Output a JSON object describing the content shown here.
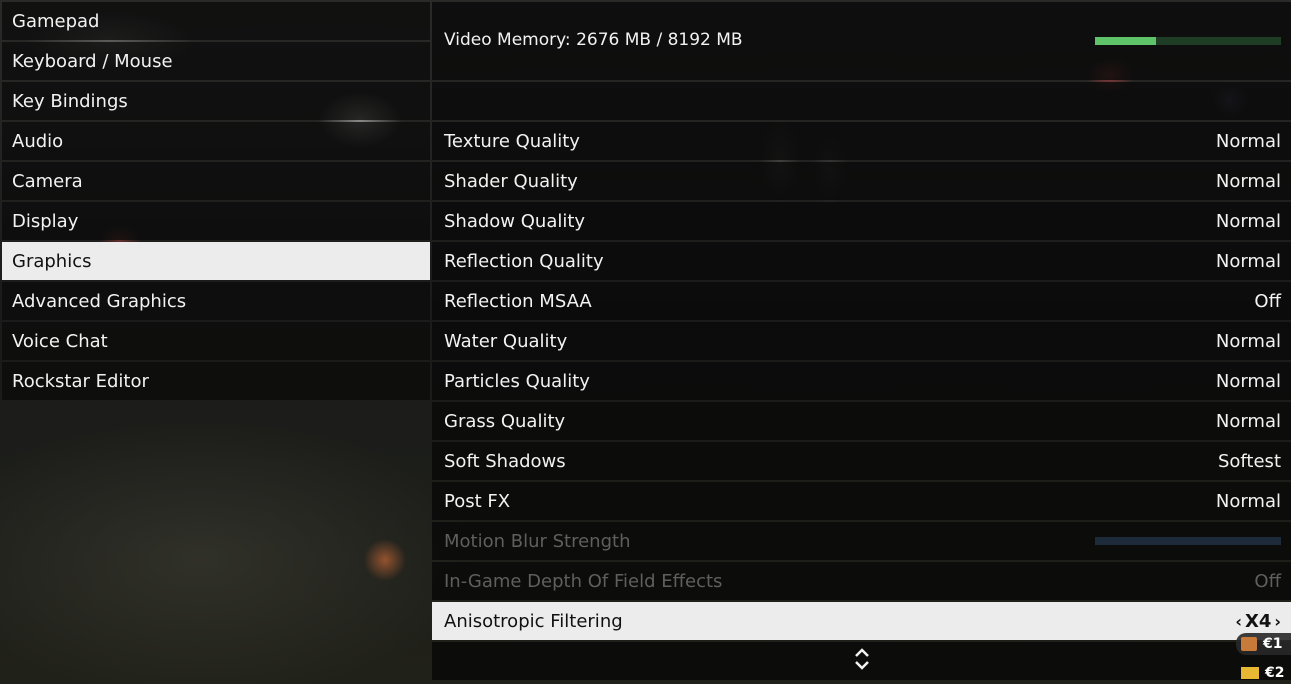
{
  "menu": {
    "items": [
      {
        "label": "Gamepad",
        "active": false
      },
      {
        "label": "Keyboard / Mouse",
        "active": false
      },
      {
        "label": "Key Bindings",
        "active": false
      },
      {
        "label": "Audio",
        "active": false
      },
      {
        "label": "Camera",
        "active": false
      },
      {
        "label": "Display",
        "active": false
      },
      {
        "label": "Graphics",
        "active": true
      },
      {
        "label": "Advanced Graphics",
        "active": false
      },
      {
        "label": "Voice Chat",
        "active": false
      },
      {
        "label": "Rockstar Editor",
        "active": false
      }
    ]
  },
  "video_memory": {
    "label": "Video Memory: 2676 MB / 8192 MB",
    "used_mb": 2676,
    "total_mb": 8192,
    "fill_fraction": 0.327
  },
  "settings": [
    {
      "label": "Texture Quality",
      "value": "Normal"
    },
    {
      "label": "Shader Quality",
      "value": "Normal"
    },
    {
      "label": "Shadow Quality",
      "value": "Normal"
    },
    {
      "label": "Reflection Quality",
      "value": "Normal"
    },
    {
      "label": "Reflection MSAA",
      "value": "Off"
    },
    {
      "label": "Water Quality",
      "value": "Normal"
    },
    {
      "label": "Particles Quality",
      "value": "Normal"
    },
    {
      "label": "Grass Quality",
      "value": "Normal"
    },
    {
      "label": "Soft Shadows",
      "value": "Softest"
    },
    {
      "label": "Post FX",
      "value": "Normal"
    },
    {
      "label": "Motion Blur Strength",
      "value": null,
      "disabled": true
    },
    {
      "label": "In-Game Depth Of Field Effects",
      "value": "Off",
      "disabled": true
    },
    {
      "label": "Anisotropic Filtering",
      "value": "X4",
      "selected": true
    }
  ],
  "selector_arrows": {
    "left": "‹",
    "right": "›"
  },
  "scroll_icon": "⬍",
  "hud": {
    "bank": "€1",
    "cash": "€2"
  },
  "colors": {
    "memory_fill": "#5fc36a",
    "selected_bg": "#ececec"
  }
}
